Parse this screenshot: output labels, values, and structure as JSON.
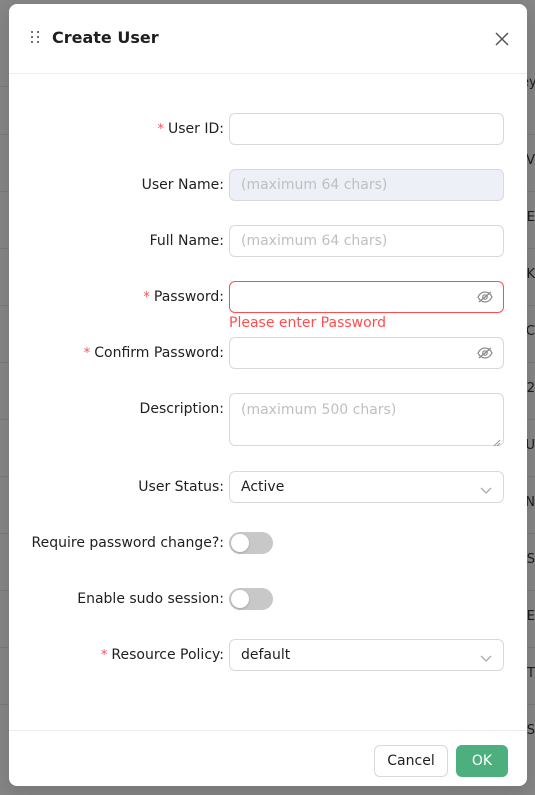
{
  "background": {
    "row_fragments": [
      "ey",
      "V",
      "E",
      "K",
      "C",
      "2",
      "U",
      "N",
      "S",
      "E",
      "T",
      "S"
    ]
  },
  "dialog": {
    "title": "Create User",
    "fields": {
      "user_id": {
        "label": "User ID",
        "required": true,
        "value": ""
      },
      "user_name": {
        "label": "User Name",
        "placeholder": "(maximum 64 chars)",
        "disabled": true
      },
      "full_name": {
        "label": "Full Name",
        "placeholder": "(maximum 64 chars)"
      },
      "password": {
        "label": "Password",
        "required": true,
        "value": "",
        "error": "Please enter Password"
      },
      "confirm_password": {
        "label": "Confirm Password",
        "required": true,
        "value": ""
      },
      "description": {
        "label": "Description",
        "placeholder": "(maximum 500 chars)"
      },
      "user_status": {
        "label": "User Status",
        "value": "Active"
      },
      "require_password_change": {
        "label": "Require password change?",
        "checked": false
      },
      "enable_sudo_session": {
        "label": "Enable sudo session",
        "checked": false
      },
      "resource_policy": {
        "label": "Resource Policy",
        "required": true,
        "value": "default"
      }
    },
    "colon": ":",
    "required_mark": "*",
    "footer": {
      "cancel_label": "Cancel",
      "ok_label": "OK"
    }
  },
  "colors": {
    "primary": "#4caf7d",
    "error": "#ff4d4f",
    "disabled_bg": "#eef0f8",
    "toggle_off": "#c8c8c8"
  },
  "icons": {
    "drag": "drag-handle-icon",
    "close": "close-icon",
    "eye": "eye-invisible-icon",
    "chevron": "chevron-down-icon"
  }
}
